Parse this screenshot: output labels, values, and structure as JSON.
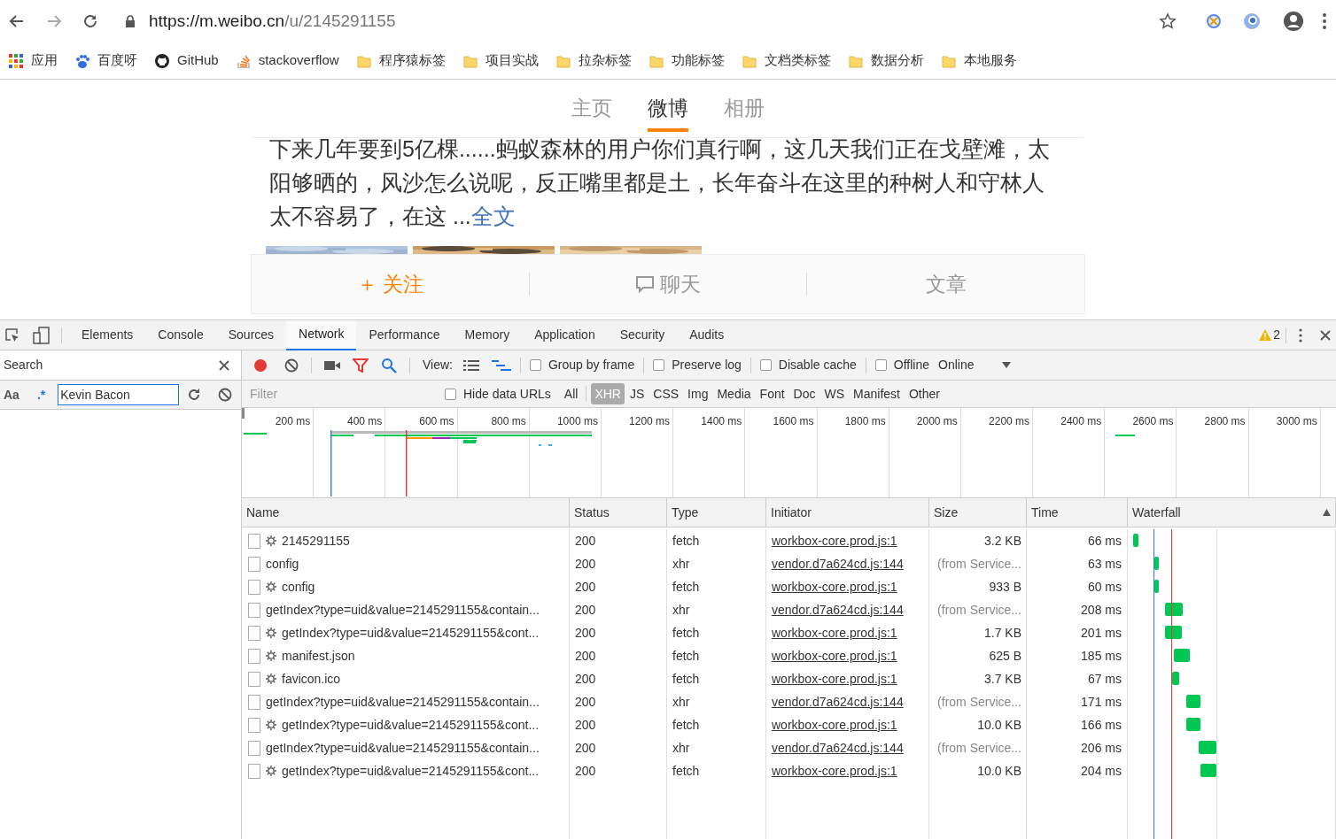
{
  "browser": {
    "url_host": "https://m.weibo.cn",
    "url_path": "/u/2145291155"
  },
  "bookmarks": [
    {
      "kind": "apps",
      "label": "应用"
    },
    {
      "kind": "paw",
      "label": "百度呀"
    },
    {
      "kind": "github",
      "label": "GitHub"
    },
    {
      "kind": "stack",
      "label": "stackoverflow"
    },
    {
      "kind": "folder",
      "label": "程序猿标签"
    },
    {
      "kind": "folder",
      "label": "项目实战"
    },
    {
      "kind": "folder",
      "label": "拉杂标签"
    },
    {
      "kind": "folder",
      "label": "功能标签"
    },
    {
      "kind": "folder",
      "label": "文档类标签"
    },
    {
      "kind": "folder",
      "label": "数据分析"
    },
    {
      "kind": "folder",
      "label": "本地服务"
    }
  ],
  "page": {
    "tabs": [
      {
        "label": "主页",
        "selected": false
      },
      {
        "label": "微博",
        "selected": true
      },
      {
        "label": "相册",
        "selected": false
      }
    ],
    "post_text": "下来几年要到5亿棵......蚂蚁森林的用户你们真行啊，这几天我们正在戈壁滩，太阳够晒的，风沙怎么说呢，反正嘴里都是土，长年奋斗在这里的种树人和守林人太不容易了，在这 ...",
    "post_link": "全文",
    "actions": [
      {
        "kind": "follow",
        "label": "关注",
        "icon": "＋"
      },
      {
        "kind": "chat",
        "label": "聊天"
      },
      {
        "kind": "article",
        "label": "文章"
      }
    ]
  },
  "devtools": {
    "tabs": [
      {
        "label": "Elements",
        "selected": false
      },
      {
        "label": "Console",
        "selected": false
      },
      {
        "label": "Sources",
        "selected": false
      },
      {
        "label": "Network",
        "selected": true
      },
      {
        "label": "Performance",
        "selected": false
      },
      {
        "label": "Memory",
        "selected": false
      },
      {
        "label": "Application",
        "selected": false
      },
      {
        "label": "Security",
        "selected": false
      },
      {
        "label": "Audits",
        "selected": false
      }
    ],
    "warning_count": "2",
    "search": {
      "title": "Search",
      "case_label": "Aa",
      "regex_label": ".*",
      "query": "Kevin Bacon"
    },
    "toolbar": {
      "recording": true,
      "view_label": "View:",
      "options": [
        {
          "label": "Group by frame",
          "checked": false
        },
        {
          "label": "Preserve log",
          "checked": false
        },
        {
          "label": "Disable cache",
          "checked": false
        },
        {
          "label": "Offline",
          "checked": false
        }
      ],
      "throttle": "Online"
    },
    "filter": {
      "placeholder": "Filter",
      "hide_data_urls": {
        "label": "Hide data URLs",
        "checked": false
      },
      "types": [
        {
          "label": "All",
          "selected": false
        },
        {
          "label": "XHR",
          "selected": true
        },
        {
          "label": "JS",
          "selected": false
        },
        {
          "label": "CSS",
          "selected": false
        },
        {
          "label": "Img",
          "selected": false
        },
        {
          "label": "Media",
          "selected": false
        },
        {
          "label": "Font",
          "selected": false
        },
        {
          "label": "Doc",
          "selected": false
        },
        {
          "label": "WS",
          "selected": false
        },
        {
          "label": "Manifest",
          "selected": false
        },
        {
          "label": "Other",
          "selected": false
        }
      ]
    },
    "overview_ticks": [
      "200 ms",
      "400 ms",
      "600 ms",
      "800 ms",
      "1000 ms",
      "1200 ms",
      "1400 ms",
      "1600 ms",
      "1800 ms",
      "2000 ms",
      "2200 ms",
      "2400 ms",
      "2600 ms",
      "2800 ms",
      "3000 ms"
    ],
    "columns": [
      "Name",
      "Status",
      "Type",
      "Initiator",
      "Size",
      "Time",
      "Waterfall"
    ],
    "rows": [
      {
        "service_worker": true,
        "name": "2145291155",
        "status": "200",
        "type": "fetch",
        "initiator": "workbox-core.prod.js:1",
        "size": "3.2 KB",
        "from_cache": false,
        "time": "66 ms"
      },
      {
        "service_worker": false,
        "name": "config",
        "status": "200",
        "type": "xhr",
        "initiator": "vendor.d7a624cd.js:144",
        "size": "(from Service...",
        "from_cache": true,
        "time": "63 ms"
      },
      {
        "service_worker": true,
        "name": "config",
        "status": "200",
        "type": "fetch",
        "initiator": "workbox-core.prod.js:1",
        "size": "933 B",
        "from_cache": false,
        "time": "60 ms"
      },
      {
        "service_worker": false,
        "name": "getIndex?type=uid&value=2145291155&contain...",
        "status": "200",
        "type": "xhr",
        "initiator": "vendor.d7a624cd.js:144",
        "size": "(from Service...",
        "from_cache": true,
        "time": "208 ms"
      },
      {
        "service_worker": true,
        "name": "getIndex?type=uid&value=2145291155&cont...",
        "status": "200",
        "type": "fetch",
        "initiator": "workbox-core.prod.js:1",
        "size": "1.7 KB",
        "from_cache": false,
        "time": "201 ms"
      },
      {
        "service_worker": true,
        "name": "manifest.json",
        "status": "200",
        "type": "fetch",
        "initiator": "workbox-core.prod.js:1",
        "size": "625 B",
        "from_cache": false,
        "time": "185 ms"
      },
      {
        "service_worker": true,
        "name": "favicon.ico",
        "status": "200",
        "type": "fetch",
        "initiator": "workbox-core.prod.js:1",
        "size": "3.7 KB",
        "from_cache": false,
        "time": "67 ms"
      },
      {
        "service_worker": false,
        "name": "getIndex?type=uid&value=2145291155&contain...",
        "status": "200",
        "type": "xhr",
        "initiator": "vendor.d7a624cd.js:144",
        "size": "(from Service...",
        "from_cache": true,
        "time": "171 ms"
      },
      {
        "service_worker": true,
        "name": "getIndex?type=uid&value=2145291155&cont...",
        "status": "200",
        "type": "fetch",
        "initiator": "workbox-core.prod.js:1",
        "size": "10.0 KB",
        "from_cache": false,
        "time": "166 ms"
      },
      {
        "service_worker": false,
        "name": "getIndex?type=uid&value=2145291155&contain...",
        "status": "200",
        "type": "xhr",
        "initiator": "vendor.d7a624cd.js:144",
        "size": "(from Service...",
        "from_cache": true,
        "time": "206 ms"
      },
      {
        "service_worker": true,
        "name": "getIndex?type=uid&value=2145291155&cont...",
        "status": "200",
        "type": "fetch",
        "initiator": "workbox-core.prod.js:1",
        "size": "10.0 KB",
        "from_cache": false,
        "time": "204 ms"
      }
    ]
  }
}
